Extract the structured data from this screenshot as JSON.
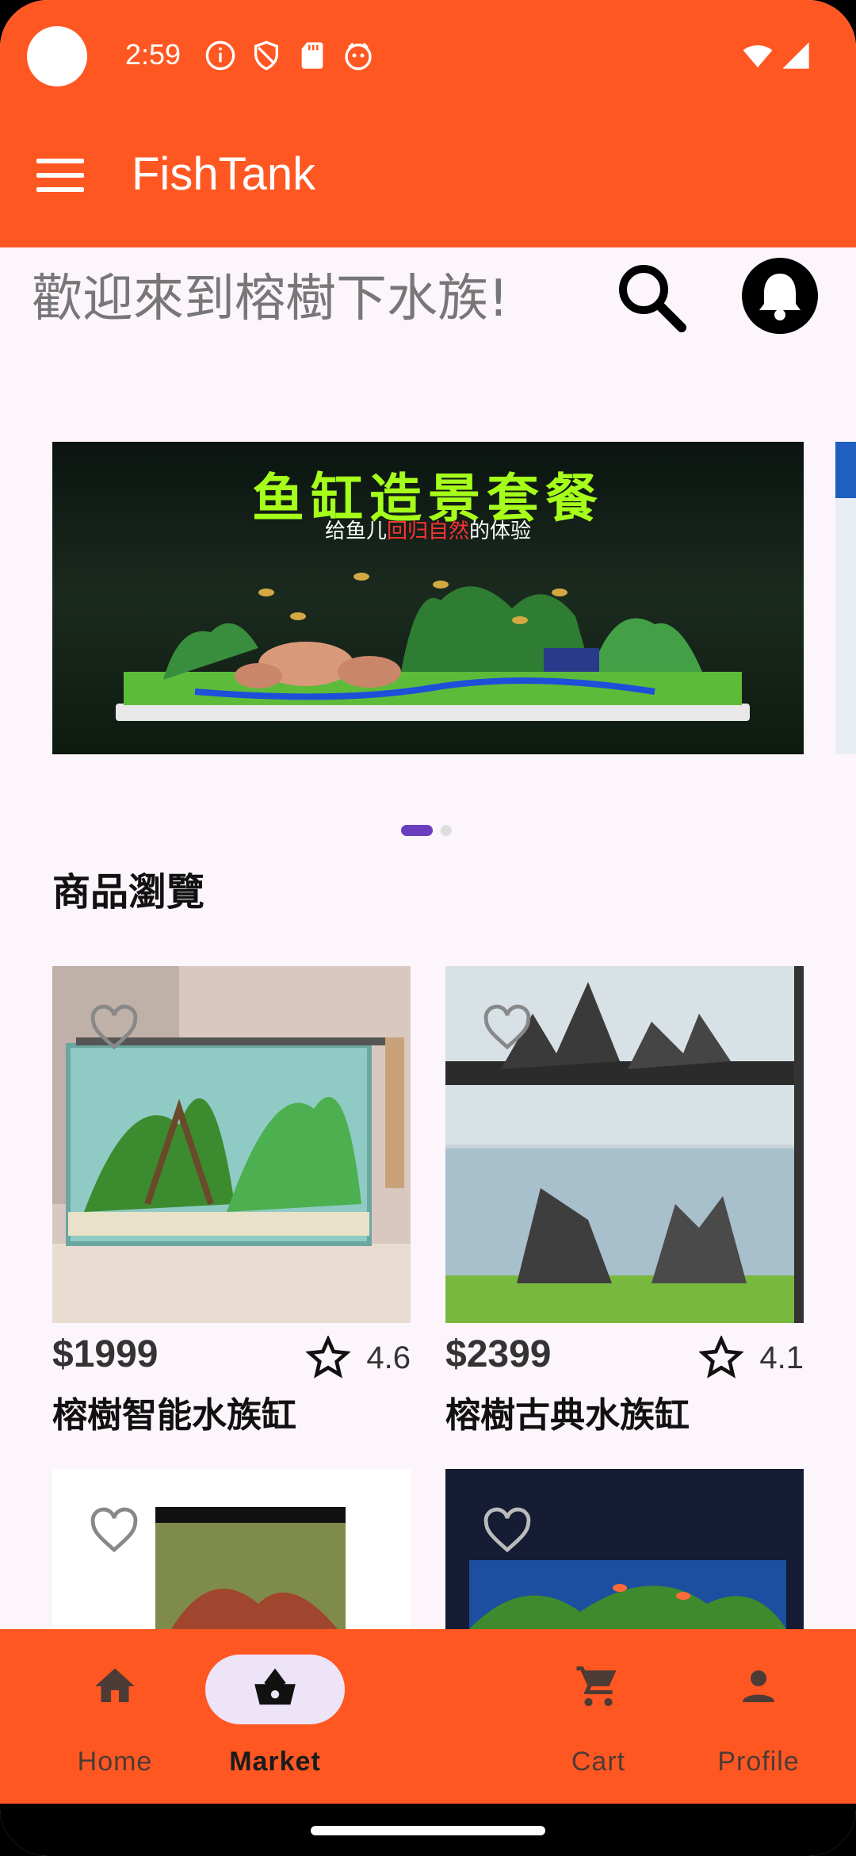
{
  "status_bar": {
    "time": "2:59"
  },
  "app_bar": {
    "title": "FishTank"
  },
  "welcome": {
    "text": "歡迎來到榕樹下水族!"
  },
  "banner": {
    "title": "鱼缸造景套餐",
    "subtitle_pre": "给鱼儿",
    "subtitle_hl": "回归自然",
    "subtitle_post": "的体验",
    "page_indicator": {
      "active": 1,
      "count": 2
    }
  },
  "section": {
    "title": "商品瀏覽"
  },
  "products": [
    {
      "price": "$1999",
      "rating": "4.6",
      "name": "榕樹智能水族缸"
    },
    {
      "price": "$2399",
      "rating": "4.1",
      "name": "榕樹古典水族缸"
    },
    {
      "price": "",
      "rating": "",
      "name": ""
    },
    {
      "price": "",
      "rating": "",
      "name": ""
    }
  ],
  "bottom_nav": {
    "items": [
      {
        "label": "Home",
        "icon": "home-icon"
      },
      {
        "label": "Market",
        "icon": "basket-icon",
        "selected": true
      },
      {
        "label": "Cart",
        "icon": "cart-icon"
      },
      {
        "label": "Profile",
        "icon": "person-icon"
      }
    ]
  },
  "colors": {
    "primary": "#ff5722",
    "indicator": "#6a3ebf",
    "nav_pill": "#ede4f7"
  }
}
